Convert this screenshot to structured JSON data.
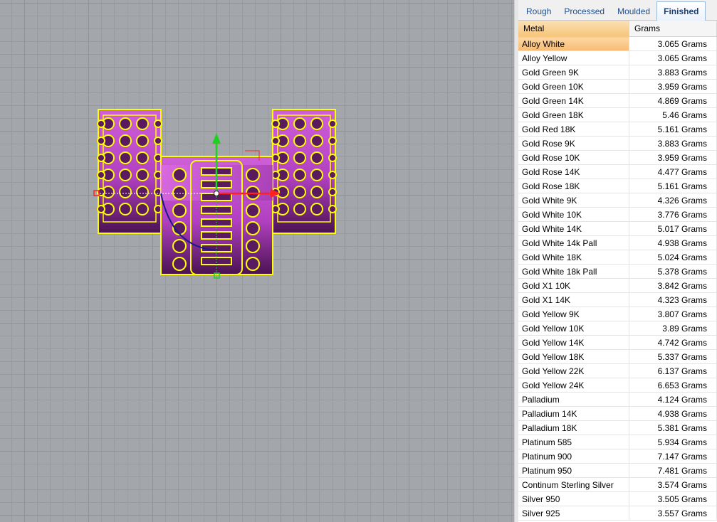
{
  "tabs": [
    {
      "label": "Rough"
    },
    {
      "label": "Processed"
    },
    {
      "label": "Moulded"
    },
    {
      "label": "Finished"
    }
  ],
  "active_tab": "Finished",
  "table": {
    "headers": {
      "metal": "Metal",
      "grams": "Grams"
    },
    "selected_row": "Alloy White",
    "rows": [
      {
        "metal": "Alloy White",
        "grams": "3.065 Grams"
      },
      {
        "metal": "Alloy Yellow",
        "grams": "3.065 Grams"
      },
      {
        "metal": "Gold Green 9K",
        "grams": "3.883 Grams"
      },
      {
        "metal": "Gold Green 10K",
        "grams": "3.959 Grams"
      },
      {
        "metal": "Gold Green 14K",
        "grams": "4.869 Grams"
      },
      {
        "metal": "Gold Green 18K",
        "grams": "5.46 Grams"
      },
      {
        "metal": "Gold Red 18K",
        "grams": "5.161 Grams"
      },
      {
        "metal": "Gold Rose 9K",
        "grams": "3.883 Grams"
      },
      {
        "metal": "Gold Rose 10K",
        "grams": "3.959 Grams"
      },
      {
        "metal": "Gold Rose 14K",
        "grams": "4.477 Grams"
      },
      {
        "metal": "Gold Rose 18K",
        "grams": "5.161 Grams"
      },
      {
        "metal": "Gold White 9K",
        "grams": "4.326 Grams"
      },
      {
        "metal": "Gold White 10K",
        "grams": "3.776 Grams"
      },
      {
        "metal": "Gold White 14K",
        "grams": "5.017 Grams"
      },
      {
        "metal": "Gold White 14k Pall",
        "grams": "4.938 Grams"
      },
      {
        "metal": "Gold White 18K",
        "grams": "5.024 Grams"
      },
      {
        "metal": "Gold White 18k Pall",
        "grams": "5.378 Grams"
      },
      {
        "metal": "Gold X1 10K",
        "grams": "3.842 Grams"
      },
      {
        "metal": "Gold X1 14K",
        "grams": "4.323 Grams"
      },
      {
        "metal": "Gold Yellow 9K",
        "grams": "3.807 Grams"
      },
      {
        "metal": "Gold Yellow 10K",
        "grams": "3.89 Grams"
      },
      {
        "metal": "Gold Yellow 14K",
        "grams": "4.742 Grams"
      },
      {
        "metal": "Gold Yellow 18K",
        "grams": "5.337 Grams"
      },
      {
        "metal": "Gold Yellow 22K",
        "grams": "6.137 Grams"
      },
      {
        "metal": "Gold Yellow 24K",
        "grams": "6.653 Grams"
      },
      {
        "metal": "Palladium",
        "grams": "4.124 Grams"
      },
      {
        "metal": "Palladium 14K",
        "grams": "4.938 Grams"
      },
      {
        "metal": "Palladium 18K",
        "grams": "5.381 Grams"
      },
      {
        "metal": "Platinum 585",
        "grams": "5.934 Grams"
      },
      {
        "metal": "Platinum 900",
        "grams": "7.147 Grams"
      },
      {
        "metal": "Platinum 950",
        "grams": "7.481 Grams"
      },
      {
        "metal": "Continum Sterling Silver",
        "grams": "3.574 Grams"
      },
      {
        "metal": "Silver 950",
        "grams": "3.505 Grams"
      },
      {
        "metal": "Silver 925",
        "grams": "3.557 Grams"
      }
    ]
  },
  "viewport": {
    "model_colors": {
      "wire": "#ffff00",
      "body": "#c050c8",
      "body_dark": "#5a1a60"
    },
    "gizmo": {
      "x_axis": "#ff2020",
      "y_axis": "#20d020"
    }
  }
}
